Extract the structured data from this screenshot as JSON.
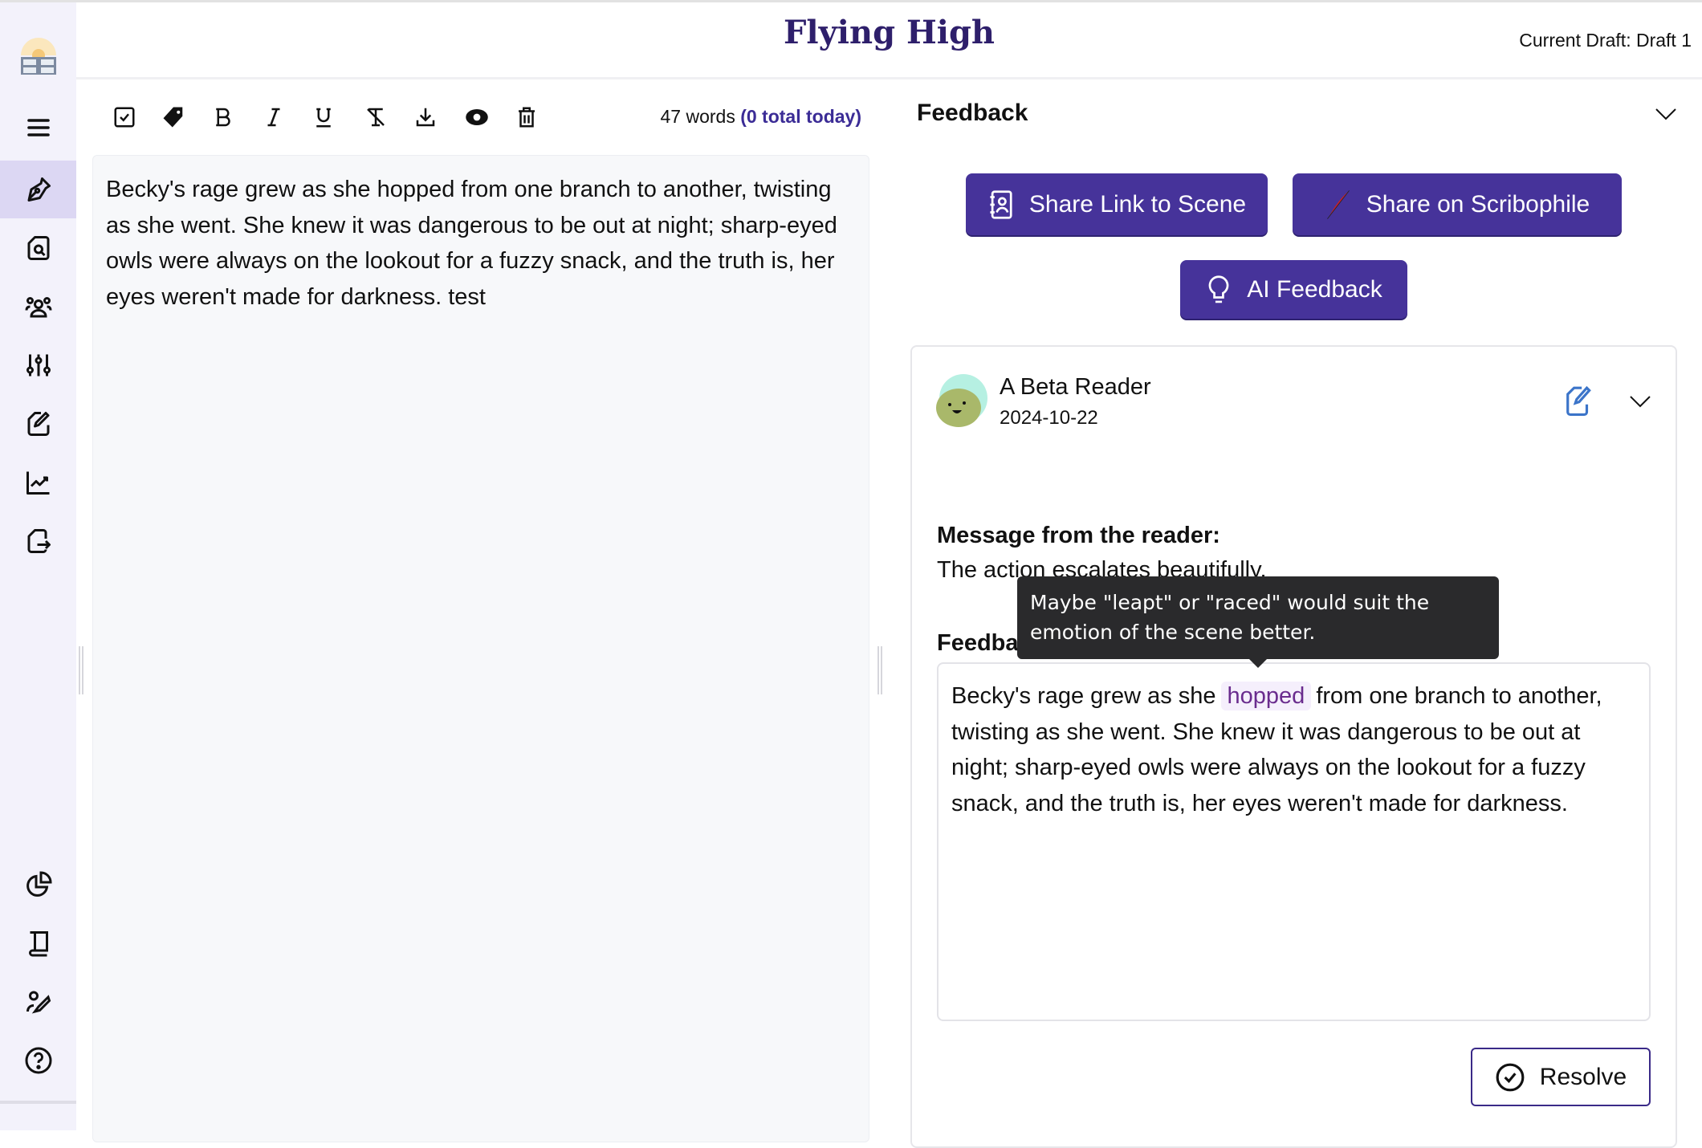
{
  "header": {
    "title": "Flying High",
    "current_draft": "Current Draft: Draft 1"
  },
  "sidebar": {
    "items": [
      {
        "icon": "menu-icon"
      },
      {
        "icon": "pen-nib-icon",
        "active": true
      },
      {
        "icon": "file-search-icon"
      },
      {
        "icon": "users-icon"
      },
      {
        "icon": "sliders-icon"
      },
      {
        "icon": "file-edit-icon"
      },
      {
        "icon": "chart-line-icon"
      },
      {
        "icon": "file-export-icon"
      },
      {
        "icon": "pie-chart-icon"
      },
      {
        "icon": "book-icon"
      },
      {
        "icon": "user-edit-icon"
      },
      {
        "icon": "help-icon"
      }
    ]
  },
  "toolbar": {
    "icons": [
      "checkbox-icon",
      "tag-icon",
      "bold-icon",
      "italic-icon",
      "underline-icon",
      "clear-format-icon",
      "download-icon",
      "eye-icon",
      "trash-icon"
    ],
    "word_count": "47 words",
    "today_count": "(0 total today)"
  },
  "editor": {
    "text": "Becky's rage grew as she hopped from one branch to another, twisting as she went. She knew it was dangerous to be out at night; sharp-eyed owls were always on the lookout for a fuzzy snack, and the truth is, her eyes weren't made for darkness. test"
  },
  "feedback": {
    "heading": "Feedback",
    "buttons": {
      "share_link": "Share Link to Scene",
      "share_scribophile": "Share on Scribophile",
      "ai_feedback": "AI Feedback"
    },
    "card": {
      "reader": "A Beta Reader",
      "date": "2024-10-22",
      "message_label": "Message from the reader:",
      "message": "The action escalates beautifully.",
      "feedback_label": "Feedback:",
      "text_before": "Becky's rage grew as she",
      "highlight": "hopped",
      "text_after": "from one branch to another, twisting as she went. She knew it was dangerous to be out at night; sharp-eyed owls were always on the lookout for a fuzzy snack, and the truth is, her eyes weren't made for darkness.",
      "tooltip": "Maybe \"leapt\" or \"raced\" would suit the emotion of the scene better.",
      "resolve": "Resolve"
    }
  },
  "colors": {
    "accent": "#46339a",
    "title": "#2e1f6b",
    "highlight_text": "#6a2c8e",
    "highlight_bg": "#f5effc",
    "edit_icon": "#3b74c9"
  }
}
